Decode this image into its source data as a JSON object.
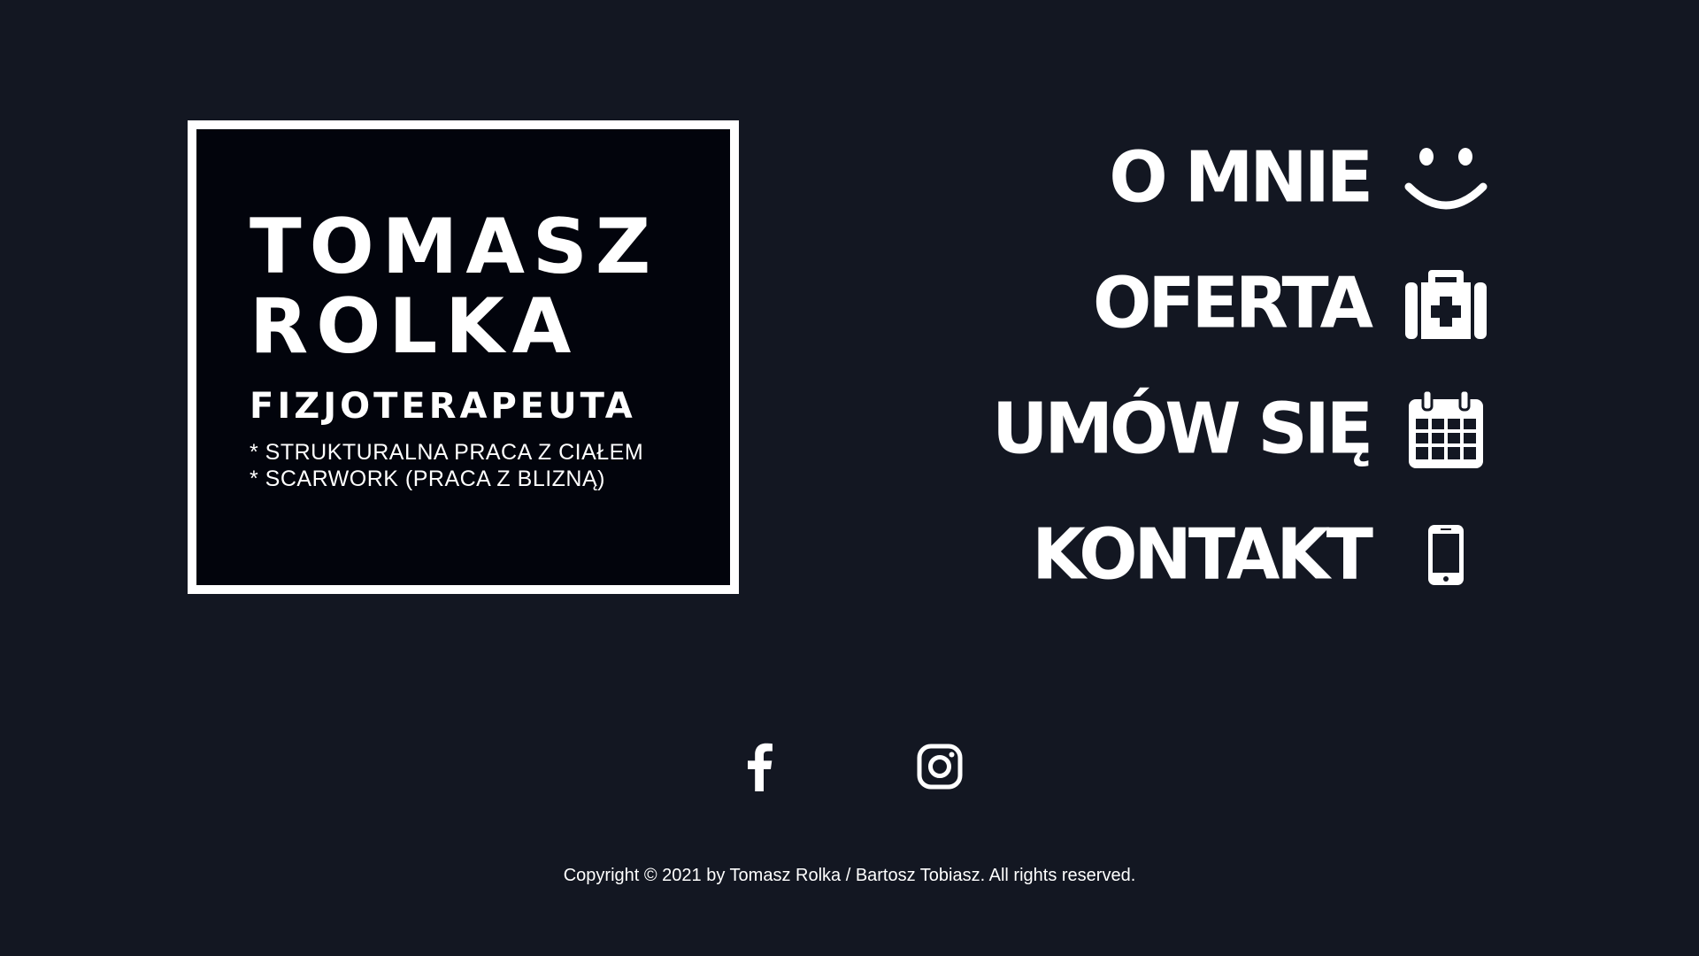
{
  "brand": {
    "name_line1": "TOMASZ",
    "name_line2": "ROLKA",
    "profession": "FIZJOTERAPEUTA",
    "specialties": [
      "* STRUKTURALNA PRACA Z CIAŁEM",
      "* SCARWORK (PRACA Z BLIZNĄ)"
    ]
  },
  "nav": {
    "items": [
      {
        "label": "O MNIE",
        "icon": "smile-icon"
      },
      {
        "label": "OFERTA",
        "icon": "first-aid-kit-icon"
      },
      {
        "label": "UMÓW SIĘ",
        "icon": "calendar-icon"
      },
      {
        "label": "KONTAKT",
        "icon": "mobile-phone-icon"
      }
    ]
  },
  "social": {
    "facebook_icon": "facebook-icon",
    "instagram_icon": "instagram-icon"
  },
  "footer": {
    "copyright": "Copyright © 2021 by Tomasz Rolka / Bartosz Tobiasz. All rights reserved."
  },
  "colors": {
    "background": "#131722",
    "card": "#02040c",
    "foreground": "#ffffff"
  }
}
